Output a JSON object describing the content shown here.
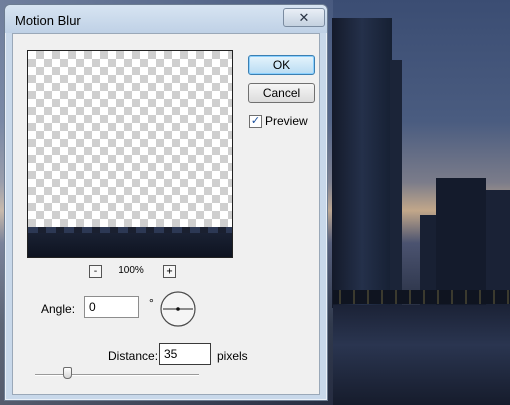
{
  "dialog": {
    "title": "Motion Blur",
    "close_glyph": "✕",
    "ok_label": "OK",
    "cancel_label": "Cancel",
    "preview_label": "Preview",
    "preview_checked": true,
    "zoom_minus_glyph": "-",
    "zoom_plus_glyph": "+",
    "zoom_level": "100%",
    "angle": {
      "label": "Angle:",
      "value": "0",
      "unit": "°"
    },
    "distance": {
      "label": "Distance:",
      "value": "35",
      "unit": "pixels"
    }
  },
  "icons": {
    "close": "close-icon",
    "check": "check-icon",
    "angle_dial": "angle-dial-icon"
  },
  "colors": {
    "dialog_frame": "#c8d8ea",
    "client_bg": "#f0f0f0",
    "ok_accent": "#3c7fb1"
  }
}
